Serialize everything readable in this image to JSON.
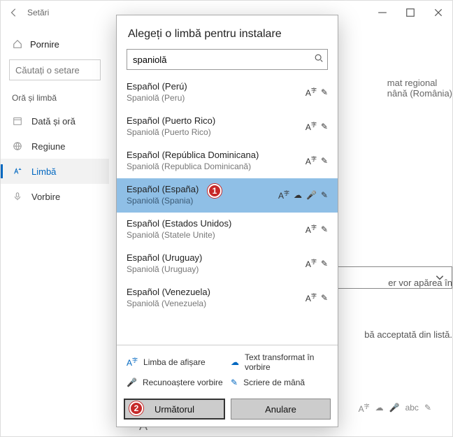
{
  "bg": {
    "title": "Setări",
    "home": "Pornire",
    "search_placeholder": "Căutați o setare",
    "section": "Oră și limbă",
    "items": [
      {
        "label": "Dată și oră"
      },
      {
        "label": "Regiune"
      },
      {
        "label": "Limbă"
      },
      {
        "label": "Vorbire"
      }
    ],
    "right_hint1": "mat regional",
    "right_hint2": "nână (România)",
    "right_hint3": "er vor apărea în",
    "right_hint4": "bă acceptată din listă."
  },
  "modal": {
    "title": "Alegeți o limbă pentru instalare",
    "search_value": "spaniolă",
    "languages": [
      {
        "name": "Español (Perú)",
        "sub": "Spaniolă (Peru)",
        "icons": [
          "display",
          "hand"
        ]
      },
      {
        "name": "Español (Puerto Rico)",
        "sub": "Spaniolă (Puerto Rico)",
        "icons": [
          "display",
          "hand"
        ]
      },
      {
        "name": "Español (República Dominicana)",
        "sub": "Spaniolă (Republica Dominicană)",
        "icons": [
          "display",
          "hand"
        ]
      },
      {
        "name": "Español (España)",
        "sub": "Spaniolă (Spania)",
        "icons": [
          "display",
          "tts",
          "speech",
          "hand"
        ],
        "selected": true
      },
      {
        "name": "Español (Estados Unidos)",
        "sub": "Spaniolă (Statele Unite)",
        "icons": [
          "display",
          "hand"
        ]
      },
      {
        "name": "Español (Uruguay)",
        "sub": "Spaniolă (Uruguay)",
        "icons": [
          "display",
          "hand"
        ]
      },
      {
        "name": "Español (Venezuela)",
        "sub": "Spaniolă (Venezuela)",
        "icons": [
          "display",
          "hand"
        ]
      }
    ],
    "legend": {
      "display": "Limba de afișare",
      "tts": "Text transformat în vorbire",
      "speech": "Recunoaștere vorbire",
      "hand": "Scriere de mână"
    },
    "next": "Următorul",
    "cancel": "Anulare"
  },
  "annotations": {
    "a1": "1",
    "a2": "2"
  }
}
